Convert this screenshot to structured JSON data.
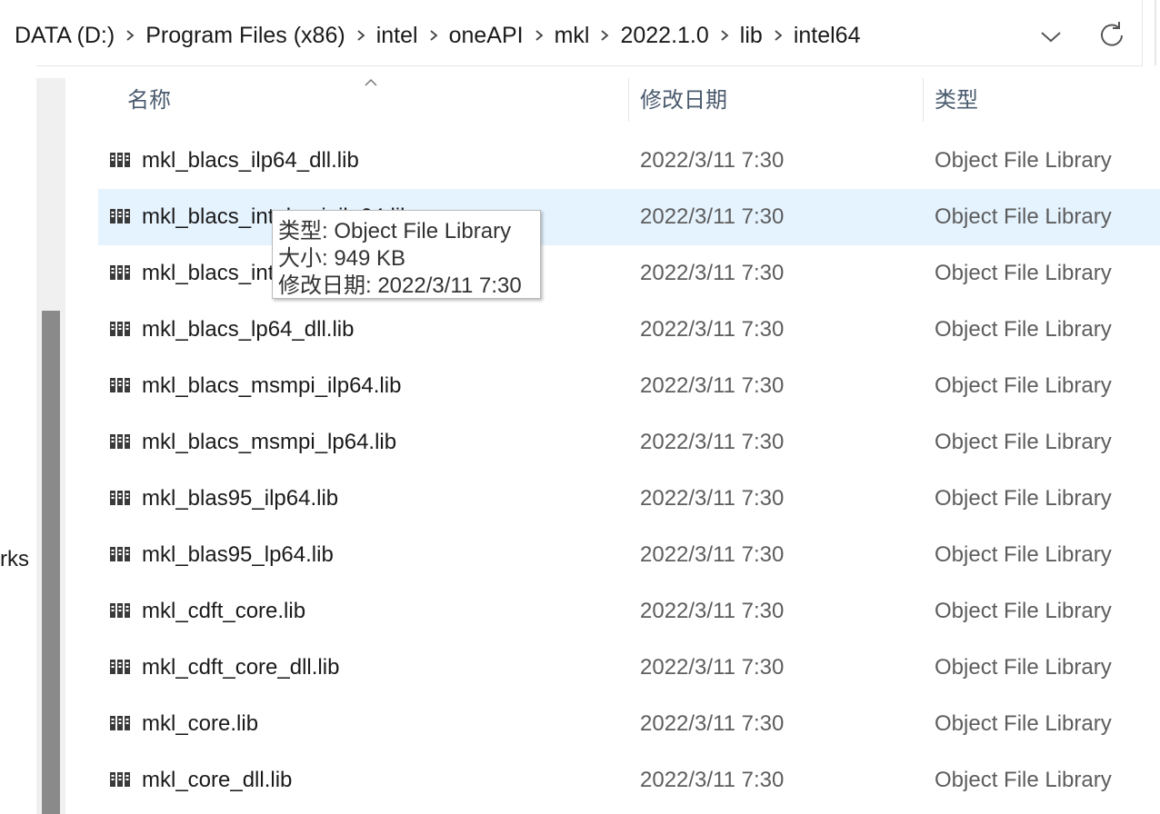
{
  "address_bar": {
    "crumbs": [
      "DATA (D:)",
      "Program Files (x86)",
      "intel",
      "oneAPI",
      "mkl",
      "2022.1.0",
      "lib",
      "intel64"
    ]
  },
  "nav_pane": {
    "partial_label": "rks"
  },
  "columns": {
    "name": "名称",
    "date": "修改日期",
    "type": "类型"
  },
  "files": [
    {
      "name": "mkl_blacs_ilp64_dll.lib",
      "date": "2022/3/11 7:30",
      "type": "Object File Library"
    },
    {
      "name": "mkl_blacs_intelmpi_ilp64.lib",
      "date": "2022/3/11 7:30",
      "type": "Object File Library"
    },
    {
      "name": "mkl_blacs_intelmpi_lp64.lib",
      "date": "2022/3/11 7:30",
      "type": "Object File Library"
    },
    {
      "name": "mkl_blacs_lp64_dll.lib",
      "date": "2022/3/11 7:30",
      "type": "Object File Library"
    },
    {
      "name": "mkl_blacs_msmpi_ilp64.lib",
      "date": "2022/3/11 7:30",
      "type": "Object File Library"
    },
    {
      "name": "mkl_blacs_msmpi_lp64.lib",
      "date": "2022/3/11 7:30",
      "type": "Object File Library"
    },
    {
      "name": "mkl_blas95_ilp64.lib",
      "date": "2022/3/11 7:30",
      "type": "Object File Library"
    },
    {
      "name": "mkl_blas95_lp64.lib",
      "date": "2022/3/11 7:30",
      "type": "Object File Library"
    },
    {
      "name": "mkl_cdft_core.lib",
      "date": "2022/3/11 7:30",
      "type": "Object File Library"
    },
    {
      "name": "mkl_cdft_core_dll.lib",
      "date": "2022/3/11 7:30",
      "type": "Object File Library"
    },
    {
      "name": "mkl_core.lib",
      "date": "2022/3/11 7:30",
      "type": "Object File Library"
    },
    {
      "name": "mkl_core_dll.lib",
      "date": "2022/3/11 7:30",
      "type": "Object File Library"
    }
  ],
  "tooltip": {
    "type_line": "类型: Object File Library",
    "size_line": "大小: 949 KB",
    "date_line": "修改日期: 2022/3/11 7:30"
  },
  "colors": {
    "hover_row": "#e5f3ff",
    "header_text": "#4a5b6e",
    "secondary_text": "#5d5d5d"
  },
  "icons": {
    "file": "library-file-icon",
    "sort": "sort-ascending-icon",
    "dropdown": "chevron-down-icon",
    "refresh": "refresh-icon",
    "separator": "chevron-right-icon"
  }
}
